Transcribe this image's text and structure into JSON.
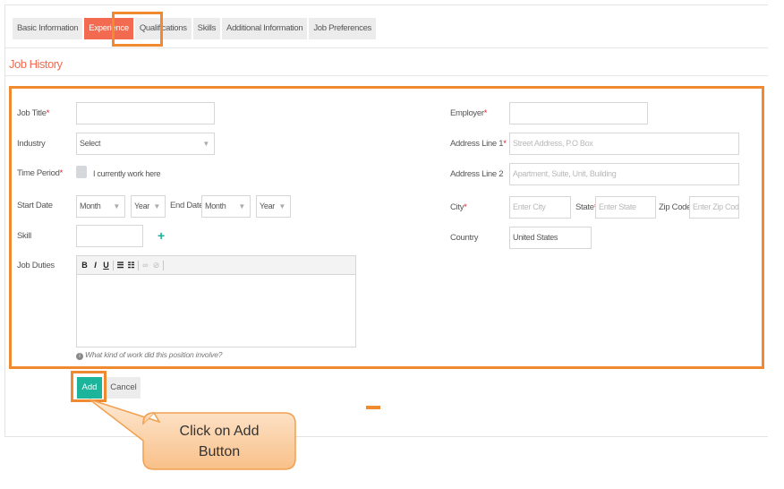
{
  "tabs": [
    {
      "label": "Basic Information"
    },
    {
      "label": "Experience"
    },
    {
      "label": "Qualifications"
    },
    {
      "label": "Skills"
    },
    {
      "label": "Additional Information"
    },
    {
      "label": "Job Preferences"
    }
  ],
  "section_title": "Job History",
  "left_form": {
    "job_title_label": "Job Title",
    "industry_label": "Industry",
    "industry_value": "Select",
    "time_period_label": "Time Period",
    "currently_work_label": "I currently work here",
    "start_date_label": "Start Date",
    "end_date_label": "End Date",
    "month_value": "Month",
    "year_value": "Year",
    "skill_label": "Skill",
    "job_duties_label": "Job Duties",
    "job_duties_hint": "What kind of work did this position involve?"
  },
  "right_form": {
    "employer_label": "Employer",
    "address1_label": "Address Line 1",
    "address1_placeholder": "Street Address, P.O Box",
    "address2_label": "Address Line 2",
    "address2_placeholder": "Apartment, Suite, Unit, Building",
    "city_label": "City",
    "city_placeholder": "Enter City",
    "state_label": "State",
    "state_placeholder": "Enter State",
    "zip_label": "Zip Code",
    "zip_placeholder": "Enter Zip Code",
    "country_label": "Country",
    "country_value": "United States"
  },
  "required_mark": "*",
  "toolbar_glyphs": {
    "bold": "B",
    "italic": "I",
    "underline": "U",
    "ul": "☰",
    "ol": "☷",
    "link": "∞",
    "unlink": "⊘"
  },
  "buttons": {
    "add": "Add",
    "cancel": "Cancel"
  },
  "callout": {
    "line1": "Click on Add",
    "line2": "Button"
  },
  "colors": {
    "accent": "#f26a4f",
    "highlight": "#f08a30",
    "add_button": "#1cb59b",
    "callout_fill": "#fcd5a8"
  }
}
